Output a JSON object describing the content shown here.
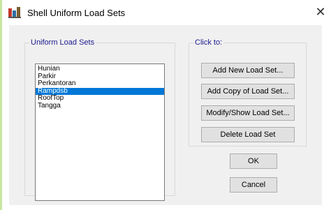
{
  "window": {
    "title": "Shell Uniform Load Sets",
    "close_glyph": "✕"
  },
  "sets_group": {
    "legend": "Uniform Load Sets",
    "items": [
      {
        "label": "Hunian",
        "selected": false
      },
      {
        "label": "Parkir",
        "selected": false
      },
      {
        "label": "Perkantoran",
        "selected": false
      },
      {
        "label": "Rampdsb",
        "selected": true
      },
      {
        "label": "RoofTop",
        "selected": false
      },
      {
        "label": "Tangga",
        "selected": false
      }
    ]
  },
  "click_group": {
    "legend": "Click to:",
    "add_new": "Add New Load Set...",
    "add_copy": "Add Copy of Load Set...",
    "modify_show": "Modify/Show Load Set...",
    "delete": "Delete Load Set"
  },
  "footer": {
    "ok": "OK",
    "cancel": "Cancel"
  },
  "colors": {
    "selection": "#0078d7",
    "legend_text": "#1a1a90",
    "dialog_bg": "#f0f0f0"
  }
}
